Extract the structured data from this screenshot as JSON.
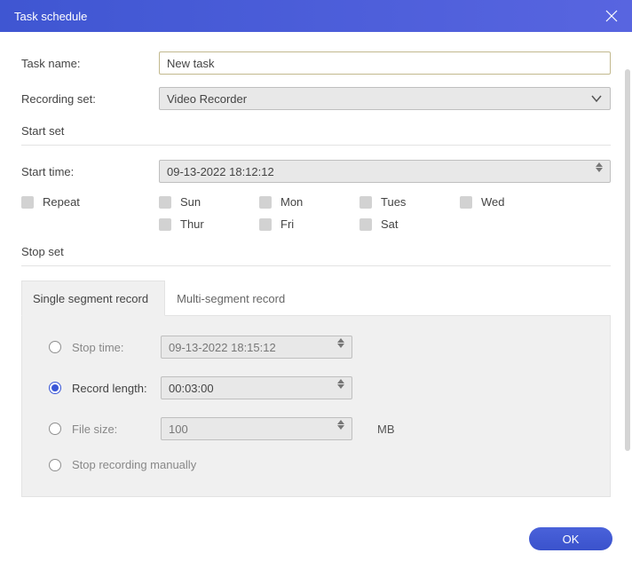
{
  "titlebar": {
    "title": "Task schedule"
  },
  "form": {
    "task_name_label": "Task name:",
    "task_name_value": "New task",
    "recording_set_label": "Recording set:",
    "recording_set_value": "Video Recorder"
  },
  "start_set": {
    "heading": "Start set",
    "start_time_label": "Start time:",
    "start_time_value": "09-13-2022 18:12:12",
    "repeat_label": "Repeat",
    "days": {
      "sun": "Sun",
      "mon": "Mon",
      "tues": "Tues",
      "wed": "Wed",
      "thur": "Thur",
      "fri": "Fri",
      "sat": "Sat"
    }
  },
  "stop_set": {
    "heading": "Stop set",
    "tabs": {
      "single": "Single segment record",
      "multi": "Multi-segment record"
    },
    "stop_time_label": "Stop time:",
    "stop_time_value": "09-13-2022 18:15:12",
    "record_length_label": "Record length:",
    "record_length_value": "00:03:00",
    "file_size_label": "File size:",
    "file_size_value": "100",
    "file_size_unit": "MB",
    "manual_label": "Stop recording manually"
  },
  "footer": {
    "ok": "OK"
  }
}
